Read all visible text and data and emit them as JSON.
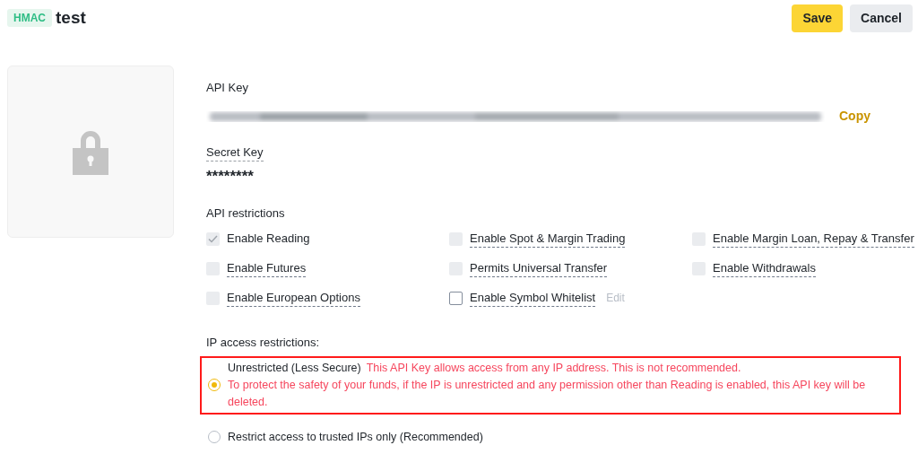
{
  "header": {
    "tag": "HMAC",
    "title": "test",
    "buttons": [
      {
        "label": "Save",
        "kind": "primary"
      },
      {
        "label": "Cancel",
        "kind": "secondary"
      }
    ]
  },
  "api_key": {
    "label": "API Key",
    "copy": "Copy"
  },
  "secret_key": {
    "label": "Secret Key",
    "value": "********"
  },
  "api_restrictions": {
    "label": "API restrictions",
    "options": [
      {
        "label": "Enable Reading",
        "checked": true,
        "disabled": true
      },
      {
        "label": "Enable Spot & Margin Trading",
        "checked": false,
        "disabled": true
      },
      {
        "label": "Enable Margin Loan, Repay & Transfer",
        "checked": false,
        "disabled": true
      },
      {
        "label": "Enable Futures",
        "checked": false,
        "disabled": true
      },
      {
        "label": "Permits Universal Transfer",
        "checked": false,
        "disabled": true
      },
      {
        "label": "Enable Withdrawals",
        "checked": false,
        "disabled": true
      },
      {
        "label": "Enable European Options",
        "checked": false,
        "disabled": true
      },
      {
        "label": "Enable Symbol Whitelist",
        "checked": false,
        "disabled": false,
        "action": "Edit"
      }
    ]
  },
  "ip_access": {
    "label": "IP access restrictions:",
    "options": [
      {
        "label": "Unrestricted (Less Secure)",
        "selected": true,
        "highlighted": true,
        "note": "This API Key allows access from any IP address. This is not recommended.",
        "warning": "To protect the safety of your funds, if the IP is unrestricted and any permission other than Reading is enabled, this API key will be deleted."
      },
      {
        "label": "Restrict access to trusted IPs only (Recommended)",
        "selected": false,
        "highlighted": false
      }
    ]
  }
}
